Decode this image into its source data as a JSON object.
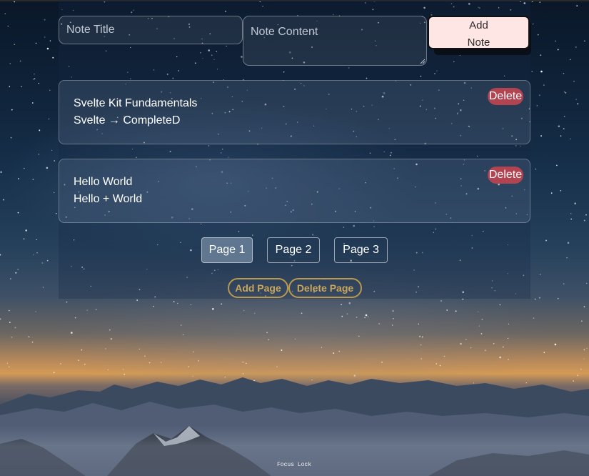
{
  "form": {
    "title_placeholder": "Note Title",
    "content_placeholder": "Note Content",
    "add_label_line1": "Add",
    "add_label_line2": "Note"
  },
  "notes": [
    {
      "title": "Svelte Kit Fundamentals",
      "body": "Svelte → CompleteD",
      "delete_label": "Delete"
    },
    {
      "title": "Hello World",
      "body": "Hello + World",
      "delete_label": "Delete"
    }
  ],
  "pagination": {
    "pages": [
      "Page 1",
      "Page 2",
      "Page 3"
    ],
    "active_index": 0
  },
  "page_actions": {
    "add_page": "Add Page",
    "delete_page": "Delete Page"
  },
  "footer": {
    "focus_lock": "Focus Lock"
  },
  "colors": {
    "add_button_bg": "#fde6e3",
    "delete_button_bg": "#b24452",
    "pill_border": "#b9994d",
    "pill_text": "#c9a65a"
  }
}
